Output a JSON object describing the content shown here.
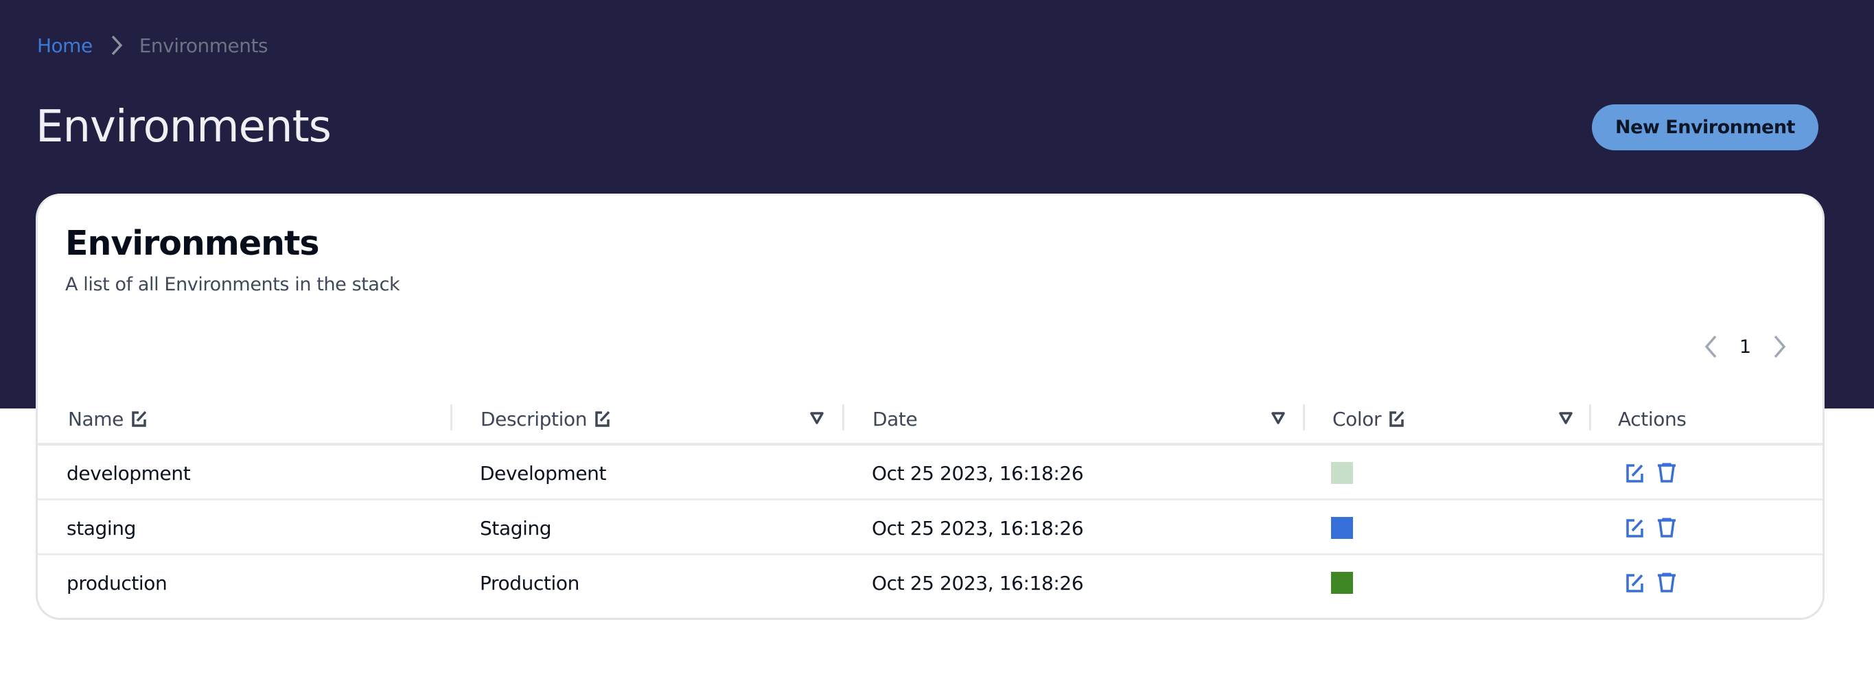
{
  "breadcrumb": {
    "home": "Home",
    "current": "Environments",
    "separator_icon": "chevron-right-icon"
  },
  "page": {
    "title": "Environments",
    "new_button": "New Environment"
  },
  "card": {
    "title": "Environments",
    "subtitle": "A list of all Environments in the stack"
  },
  "pagination": {
    "current_page": "1",
    "prev_icon": "chevron-left-icon",
    "next_icon": "chevron-right-icon"
  },
  "table": {
    "columns": [
      {
        "label": "Name",
        "editable": true,
        "filterable": false
      },
      {
        "label": "Description",
        "editable": true,
        "filterable": true
      },
      {
        "label": "Date",
        "editable": false,
        "filterable": true
      },
      {
        "label": "Color",
        "editable": true,
        "filterable": true
      },
      {
        "label": "Actions",
        "editable": false,
        "filterable": false
      }
    ],
    "rows": [
      {
        "name": "development",
        "description": "Development",
        "date": "Oct 25 2023, 16:18:26",
        "color": "#c8e0c8"
      },
      {
        "name": "staging",
        "description": "Staging",
        "date": "Oct 25 2023, 16:18:26",
        "color": "#3670d8"
      },
      {
        "name": "production",
        "description": "Production",
        "date": "Oct 25 2023, 16:18:26",
        "color": "#3e8724"
      }
    ],
    "row_actions": [
      "edit-icon",
      "trash-icon"
    ]
  },
  "colors": {
    "header_bg": "#211f42",
    "accent": "#649cdd",
    "link": "#3d7ad6",
    "action_icon": "#3670d8"
  }
}
